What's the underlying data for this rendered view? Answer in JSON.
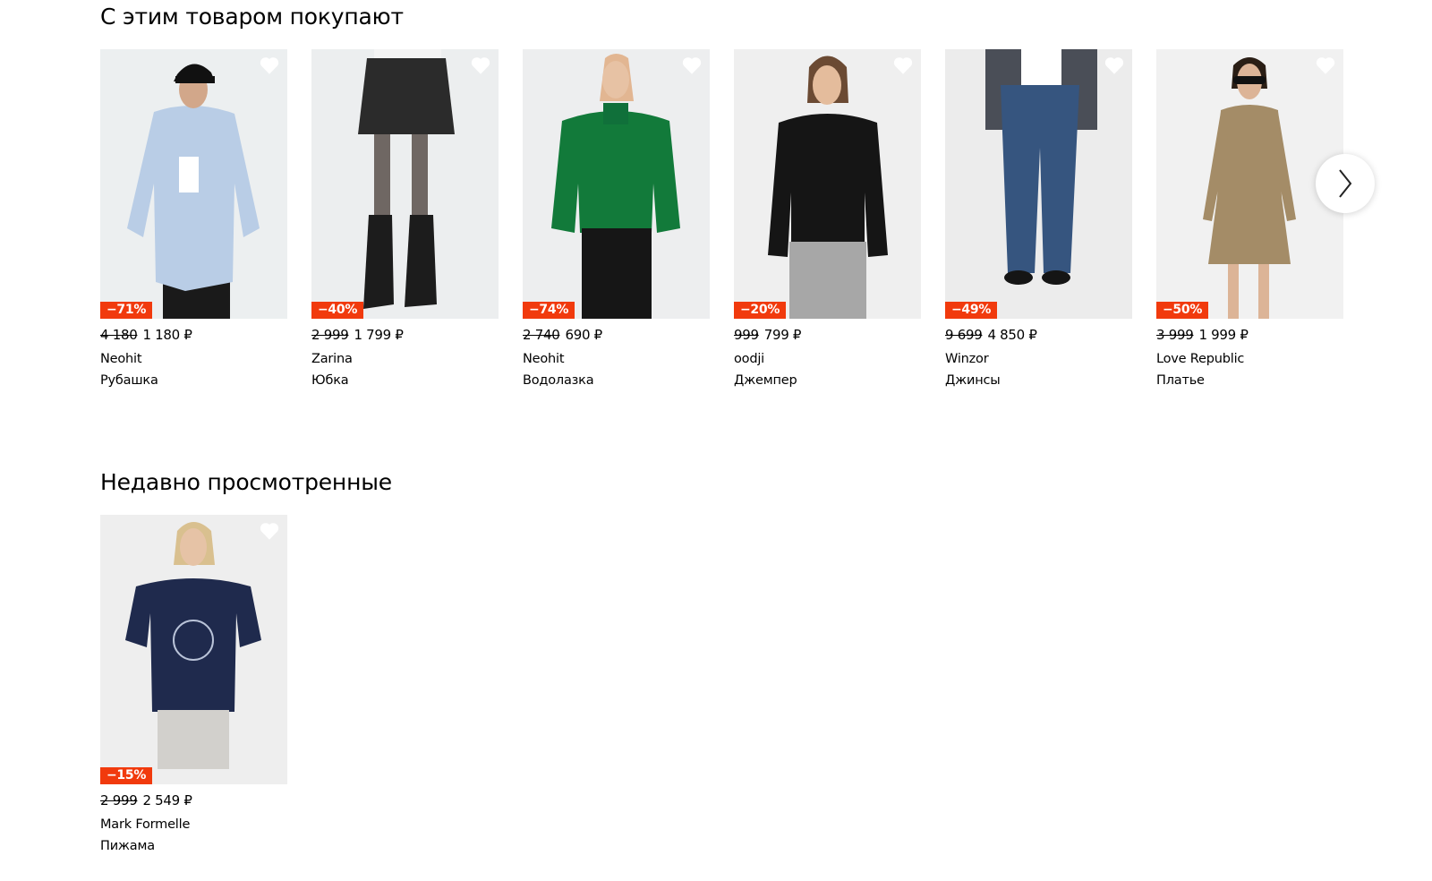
{
  "sections": {
    "bought_with": {
      "title": "С этим товаром покупают",
      "products": [
        {
          "discount": "−71%",
          "old_price": "4 180",
          "price": "1 180 ₽",
          "brand": "Neohit",
          "type": "Рубашка"
        },
        {
          "discount": "−40%",
          "old_price": "2 999",
          "price": "1 799 ₽",
          "brand": "Zarina",
          "type": "Юбка"
        },
        {
          "discount": "−74%",
          "old_price": "2 740",
          "price": "690 ₽",
          "brand": "Neohit",
          "type": "Водолазка"
        },
        {
          "discount": "−20%",
          "old_price": "999",
          "price": "799 ₽",
          "brand": "oodji",
          "type": "Джемпер"
        },
        {
          "discount": "−49%",
          "old_price": "9 699",
          "price": "4 850 ₽",
          "brand": "Winzor",
          "type": "Джинсы"
        },
        {
          "discount": "−50%",
          "old_price": "3 999",
          "price": "1 999 ₽",
          "brand": "Love Republic",
          "type": "Платье"
        }
      ]
    },
    "recently_viewed": {
      "title": "Недавно просмотренные",
      "products": [
        {
          "discount": "−15%",
          "old_price": "2 999",
          "price": "2 549 ₽",
          "brand": "Mark Formelle",
          "type": "Пижама"
        }
      ]
    }
  },
  "icons": {
    "favorite": "heart-outline-icon",
    "carousel_next": "chevron-right-icon"
  },
  "colors": {
    "discount_badge": "#f13a0d",
    "text": "#000000",
    "photo_background": "#e9ebec"
  }
}
